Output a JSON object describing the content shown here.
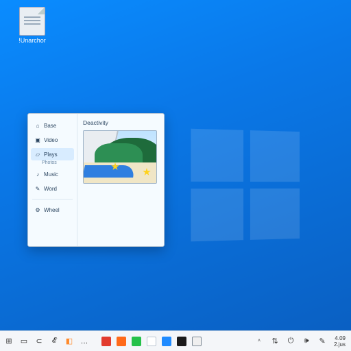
{
  "desktop": {
    "icons": [
      {
        "label": "!Unarchor"
      }
    ]
  },
  "panel": {
    "sidebar": {
      "items": [
        {
          "label": "Base",
          "icon": "home-icon"
        },
        {
          "label": "Video",
          "icon": "video-icon"
        },
        {
          "label": "Plays",
          "icon": "image-icon",
          "sub": "Photos"
        },
        {
          "label": "Music",
          "icon": "music-icon"
        },
        {
          "label": "Word",
          "icon": "doc-icon"
        }
      ],
      "footer": {
        "label": "Wheel",
        "icon": "gear-icon"
      }
    },
    "content": {
      "header": "Deactivity",
      "thumbnail_alt": "coastal landscape theme"
    }
  },
  "taskbar": {
    "left": [
      {
        "name": "start-button",
        "glyph": "⊞"
      },
      {
        "name": "taskview-button",
        "glyph": "▭"
      },
      {
        "name": "back-button",
        "glyph": "⊂"
      },
      {
        "name": "link-button",
        "glyph": "𝓔"
      },
      {
        "name": "app-pin-1",
        "glyph": "◧",
        "color": "#ff8a2b"
      },
      {
        "name": "app-pin-2",
        "glyph": "…"
      }
    ],
    "pinned": [
      {
        "name": "pinned-app-red",
        "color": "#e23b2e"
      },
      {
        "name": "pinned-app-orange",
        "color": "#ff6a1a"
      },
      {
        "name": "pinned-app-green",
        "color": "#25c14a"
      },
      {
        "name": "pinned-app-white",
        "color": "#ffffff",
        "border": "#b9c5d0"
      },
      {
        "name": "pinned-app-blue",
        "color": "#1f8bff"
      },
      {
        "name": "pinned-app-black",
        "color": "#1a1a1a"
      },
      {
        "name": "pinned-app-term",
        "color": "#efefef",
        "border": "#7b8894"
      }
    ],
    "tray": [
      {
        "name": "tray-up-icon",
        "glyph": "˄"
      },
      {
        "name": "tray-network-icon",
        "glyph": "⇅"
      },
      {
        "name": "tray-power-icon",
        "glyph": "⏻"
      },
      {
        "name": "tray-volume-icon",
        "glyph": "🕪"
      },
      {
        "name": "tray-pen-icon",
        "glyph": "✎"
      }
    ],
    "clock": {
      "time": "4.09",
      "date": "2.jus"
    }
  }
}
